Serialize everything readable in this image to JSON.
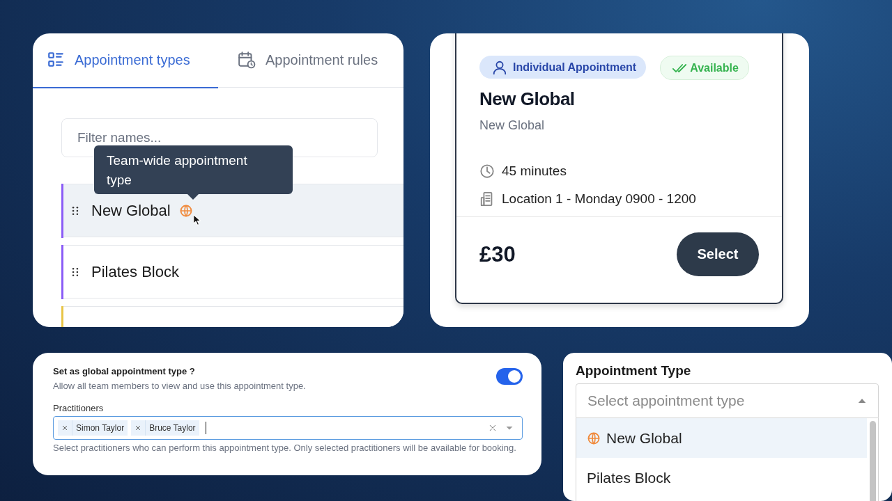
{
  "appointment_types_panel": {
    "tabs": [
      {
        "label": "Appointment types",
        "selected": true,
        "kind": "list"
      },
      {
        "label": "Appointment rules",
        "selected": false,
        "kind": "calendar"
      }
    ],
    "filter": {
      "placeholder": "Filter names..."
    },
    "tooltip": {
      "text": "Team-wide appointment type"
    },
    "items": [
      {
        "name": "New Global",
        "global": true,
        "highlighted": true,
        "color": "#8b5cf6"
      },
      {
        "name": "Pilates Block",
        "global": false,
        "highlighted": false,
        "color": "#8b5cf6"
      },
      {
        "color": "#e8c547"
      }
    ]
  },
  "booking_card": {
    "badges": [
      {
        "kind": "type",
        "label": "Individual Appointment"
      },
      {
        "kind": "status",
        "label": "Available"
      }
    ],
    "title": "New Global",
    "subtitle": "New Global",
    "details": [
      {
        "kind": "duration",
        "text": "45 minutes"
      },
      {
        "kind": "location",
        "text": "Location 1 - Monday 0900 - 1200"
      }
    ],
    "price": "£30",
    "button": "Select"
  },
  "global_settings": {
    "toggle": {
      "label": "Set as global appointment type ?",
      "description": "Allow all team members to view and use this appointment type.",
      "on": true
    },
    "practitioners": {
      "label": "Practitioners",
      "chips": [
        "Simon Taylor",
        "Bruce Taylor"
      ],
      "help": "Select practitioners who can perform this appointment type. Only selected practitioners will be available for booking."
    }
  },
  "appointment_type_select": {
    "label": "Appointment Type",
    "placeholder": "Select appointment type",
    "expanded": true,
    "options": [
      {
        "label": "New Global",
        "global": true,
        "highlighted": true
      },
      {
        "label": "Pilates Block",
        "global": false,
        "highlighted": false
      }
    ]
  }
}
